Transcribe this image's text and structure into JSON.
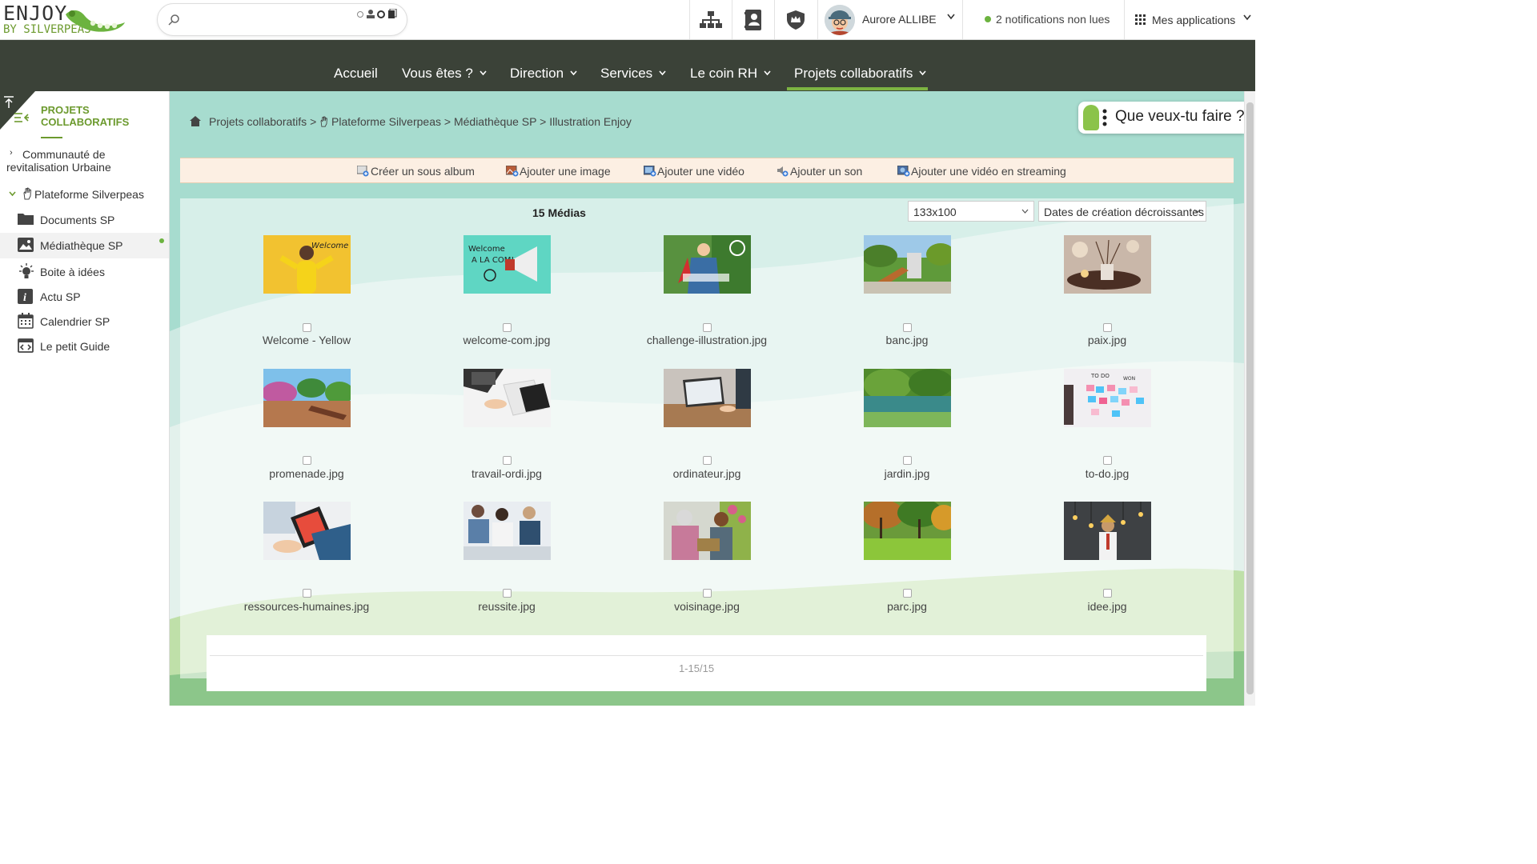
{
  "logo": {
    "line1": "ENJOY",
    "line2": "BY SILVERPEAS"
  },
  "search": {
    "placeholder": ""
  },
  "header": {
    "user_name": "Aurore ALLIBE",
    "notifications": "2 notifications non lues",
    "apps_label": "Mes applications"
  },
  "nav": {
    "items": [
      "Accueil",
      "Vous êtes ?",
      "Direction",
      "Services",
      "Le coin RH",
      "Projets collaboratifs"
    ],
    "active": "Projets collaboratifs"
  },
  "sidebar": {
    "title_line1": "PROJETS",
    "title_line2": "COLLABORATIFS",
    "items": [
      {
        "label": "Communauté de revitalisation Urbaine"
      },
      {
        "label": "Plateforme Silverpeas"
      },
      {
        "label": "Documents SP"
      },
      {
        "label": "Médiathèque SP"
      },
      {
        "label": "Boite à idées"
      },
      {
        "label": "Actu SP"
      },
      {
        "label": "Calendrier SP"
      },
      {
        "label": "Le petit Guide"
      }
    ]
  },
  "breadcrumb": {
    "part1": "Projets collaboratifs",
    "part2": "Plateforme Silverpeas",
    "part3": "Médiathèque SP",
    "part4": "Illustration Enjoy",
    "sep": ">"
  },
  "help_button": "Que veux-tu faire ?",
  "actions": [
    "Créer un sous album",
    "Ajouter une image",
    "Ajouter une vidéo",
    "Ajouter un son",
    "Ajouter une vidéo en streaming"
  ],
  "gallery": {
    "count": "15 Médias",
    "size_select": "133x100",
    "sort_select": "Dates de création décroissantes",
    "pagination": "1-15/15",
    "media": [
      "Welcome - Yellow",
      "welcome-com.jpg",
      "challenge-illustration.jpg",
      "banc.jpg",
      "paix.jpg",
      "promenade.jpg",
      "travail-ordi.jpg",
      "ordinateur.jpg",
      "jardin.jpg",
      "to-do.jpg",
      "ressources-humaines.jpg",
      "reussite.jpg",
      "voisinage.jpg",
      "parc.jpg",
      "idee.jpg"
    ]
  },
  "colors": {
    "nav_bg": "#3b4238",
    "accent": "#6c9a2e",
    "main_bg": "#a6d9cd",
    "toolbar_bg": "#fcefe3"
  }
}
